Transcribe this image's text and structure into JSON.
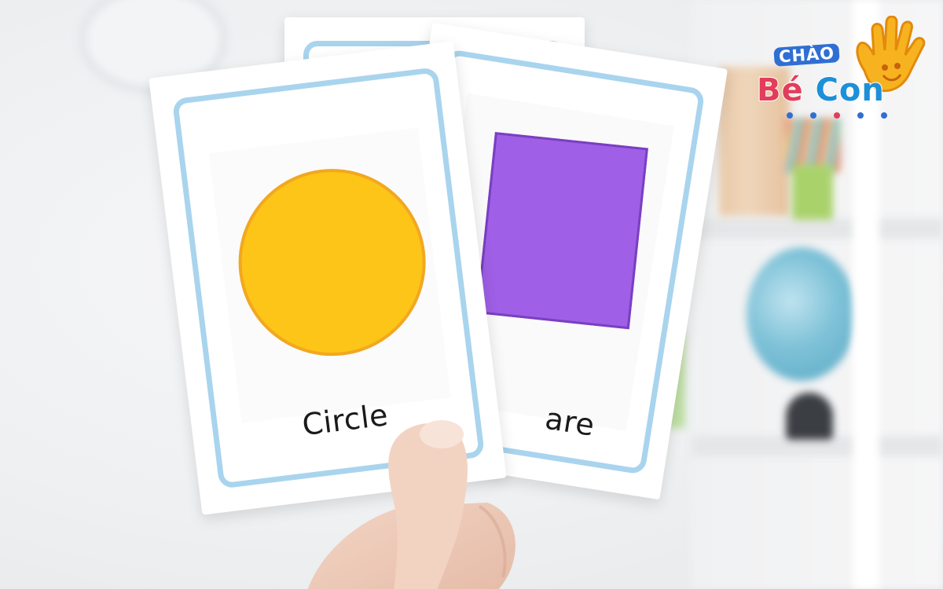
{
  "cards": {
    "front": {
      "label": "Circle",
      "shape": "circle",
      "shape_color": "#fdc517"
    },
    "middle": {
      "label": "Square",
      "shape": "square",
      "shape_color": "#9f5fe6"
    },
    "frame_color": "#a9d4ee"
  },
  "logo": {
    "top_word": "CHÀO",
    "word_be": "Bé",
    "word_con": "Con",
    "colors": {
      "be": "#e23d5a",
      "con": "#1c90d8",
      "hand": "#f7b31f"
    }
  }
}
